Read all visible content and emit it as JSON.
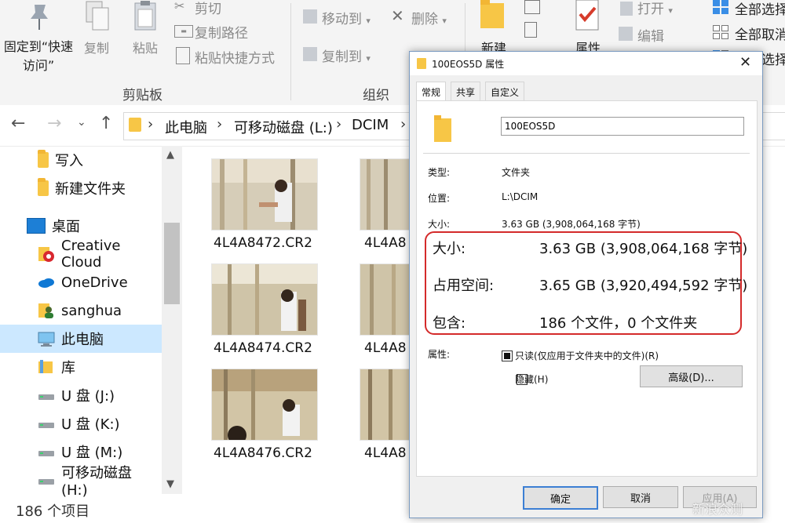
{
  "ribbon": {
    "pin_label": "固定到“快速访问”",
    "copy_label": "复制",
    "paste_label": "粘贴",
    "cut_label": "剪切",
    "copy_path_label": "复制路径",
    "paste_shortcut_label": "粘贴快捷方式",
    "clipboard_group": "剪贴板",
    "move_to_label": "移动到",
    "copy_to_label": "复制到",
    "delete_label": "删除",
    "organize_group": "组织",
    "new_label": "新建",
    "properties_label": "属性",
    "open_label": "打开",
    "edit_label": "编辑",
    "select_all_label": "全部选择",
    "select_none_label": "全部取消",
    "invert_select_label": "反向选择"
  },
  "address": {
    "crumbs": [
      "此电脑",
      "可移动磁盘 (L:)",
      "DCIM"
    ]
  },
  "nav": {
    "items": [
      {
        "label": "写入",
        "icon": "folder-icon"
      },
      {
        "label": "新建文件夹",
        "icon": "folder-icon"
      },
      {
        "label": "桌面",
        "icon": "desktop-icon"
      },
      {
        "label": "Creative Cloud",
        "icon": "creative-cloud-icon"
      },
      {
        "label": "OneDrive",
        "icon": "onedrive-icon"
      },
      {
        "label": "sanghua",
        "icon": "user-folder-icon"
      },
      {
        "label": "此电脑",
        "icon": "this-pc-icon"
      },
      {
        "label": "库",
        "icon": "library-icon"
      },
      {
        "label": "U 盘 (J:)",
        "icon": "drive-icon"
      },
      {
        "label": "U 盘 (K:)",
        "icon": "drive-icon"
      },
      {
        "label": "U 盘 (M:)",
        "icon": "drive-icon"
      },
      {
        "label": "可移动磁盘 (H:)",
        "icon": "drive-icon"
      }
    ]
  },
  "files": {
    "items": [
      "4L4A8472.CR2",
      "4L4A8474.CR2",
      "4L4A8476.CR2"
    ],
    "partial": [
      "4L4A8",
      "4L4A8",
      "4L4A8"
    ]
  },
  "status": {
    "count": "186 个项目"
  },
  "dialog": {
    "title": "100EOS5D 属性",
    "tabs": [
      "常规",
      "共享",
      "自定义"
    ],
    "name_value": "100EOS5D",
    "type_label": "类型:",
    "type_value": "文件夹",
    "location_label": "位置:",
    "location_value": "L:\\DCIM",
    "size_label_small": "大小:",
    "size_value_small": "3.63 GB (3,908,064,168 字节)",
    "size_label": "大小:",
    "size_value": "3.63 GB (3,908,064,168 字节)",
    "ondisk_label": "占用空间:",
    "ondisk_value": "3.65 GB (3,920,494,592 字节)",
    "contains_label": "包含:",
    "contains_value": "186 个文件，0 个文件夹",
    "attributes_label": "属性:",
    "readonly_label": "只读(仅应用于文件夹中的文件)(R)",
    "hidden_label": "隐藏(H)",
    "advanced_label": "高级(D)...",
    "ok_label": "确定",
    "cancel_label": "取消",
    "apply_label": "应用(A)",
    "readonly_checked": true,
    "hidden_checked": false,
    "highlight_color": "#d42a2a"
  },
  "watermark": "新浪众测"
}
